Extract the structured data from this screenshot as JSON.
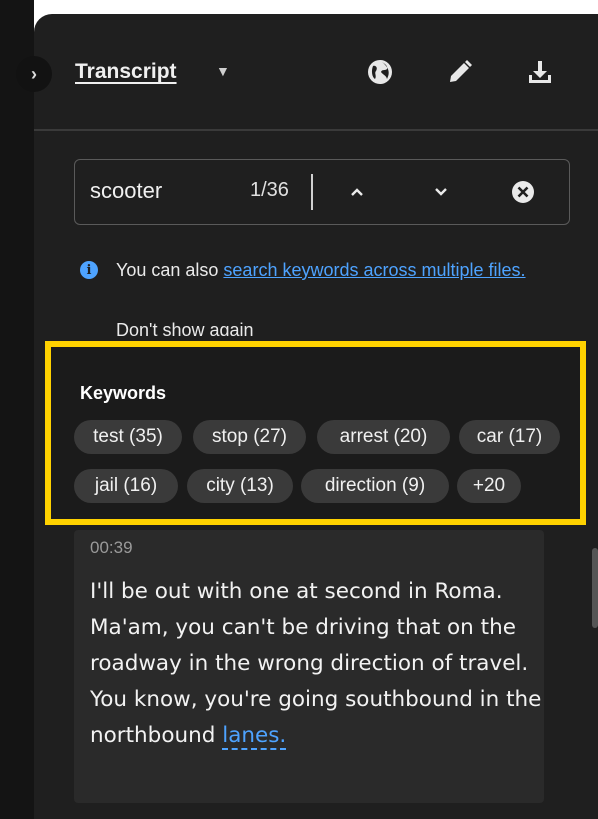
{
  "header": {
    "title": "Transcript"
  },
  "search": {
    "value": "scooter",
    "match_count": "1/36"
  },
  "info": {
    "prefix": "You can also ",
    "link_text": "search keywords across multiple files.",
    "dismiss": "Don't show again"
  },
  "keywords": {
    "title": "Keywords",
    "chips": [
      "test (35)",
      "stop (27)",
      "arrest (20)",
      "car (17)",
      "jail (16)",
      "city (13)",
      "direction (9)",
      "+20"
    ]
  },
  "transcript": {
    "timestamp": "00:39",
    "text": "I'll be out with one at second in Roma. Ma'am, you can't be driving that on the roadway in the wrong direction of travel. You know, you're going southbound in the northbound ",
    "highlight_word": "lanes."
  },
  "colors": {
    "accent": "#4ea3ff",
    "highlight_border": "#ffd200"
  },
  "icons": [
    "chevron-right-icon",
    "caret-down-icon",
    "globe-icon",
    "pencil-icon",
    "download-icon",
    "chevron-up-icon",
    "chevron-down-icon",
    "clear-icon",
    "info-icon"
  ]
}
